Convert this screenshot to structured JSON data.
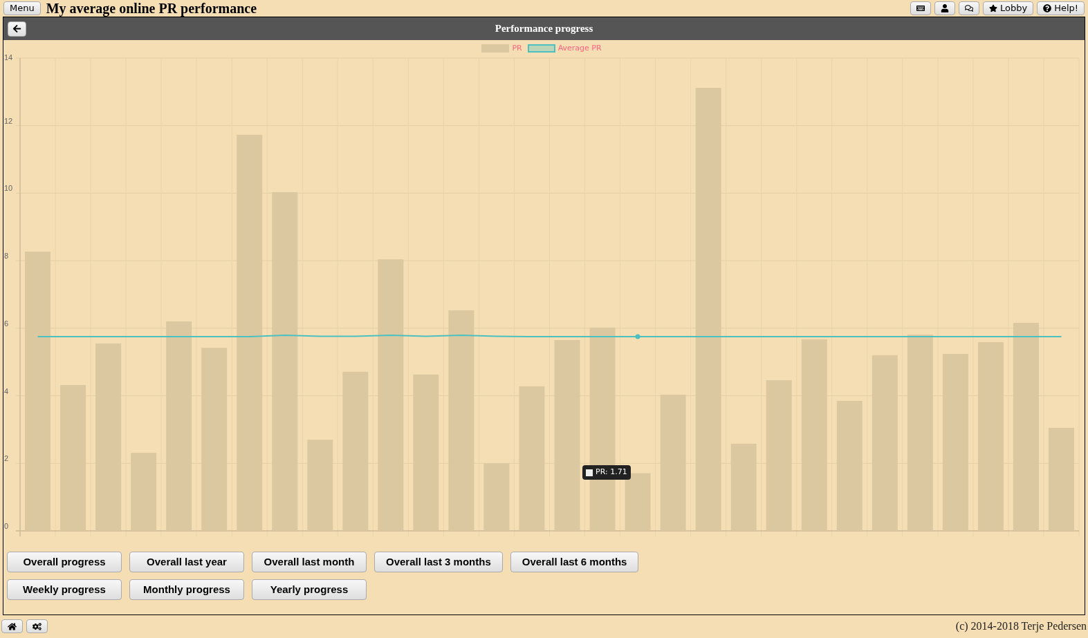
{
  "menu_button": "Menu",
  "page_title": "My average online PR performance",
  "toolbar": [
    {
      "kind": "keyboard"
    },
    {
      "kind": "user"
    },
    {
      "kind": "chat"
    },
    {
      "kind": "star",
      "label": "Lobby"
    },
    {
      "kind": "help",
      "label": "Help!"
    }
  ],
  "panel": {
    "title": "Performance progress",
    "chart_data": {
      "type": "bar",
      "grid": true,
      "legend": "top",
      "ylim": [
        0,
        14
      ],
      "yticks": [
        0,
        2,
        4,
        6,
        8,
        10,
        12,
        14
      ],
      "series": [
        {
          "name": "PR",
          "color": "#dcc8a0",
          "values": [
            8.27,
            4.32,
            5.55,
            2.31,
            6.2,
            5.42,
            11.73,
            10.03,
            2.7,
            4.71,
            8.04,
            4.63,
            6.53,
            2.0,
            4.28,
            5.65,
            6.02,
            1.71,
            4.03,
            13.12,
            2.58,
            4.46,
            5.67,
            3.85,
            5.2,
            5.81,
            5.24,
            5.59,
            6.16,
            3.05
          ]
        },
        {
          "name": "Average PR",
          "type": "line",
          "color": "#4bc0c0",
          "values": [
            5.75,
            5.75,
            5.75,
            5.75,
            5.75,
            5.75,
            5.75,
            5.79,
            5.76,
            5.76,
            5.79,
            5.76,
            5.79,
            5.76,
            5.75,
            5.75,
            5.75,
            5.75,
            5.75,
            5.75,
            5.75,
            5.75,
            5.75,
            5.75,
            5.75,
            5.75,
            5.75,
            5.75,
            5.75,
            5.75
          ]
        }
      ],
      "annotations": [
        "PR: 1.71"
      ]
    },
    "buttons": [
      [
        "Overall progress",
        "Overall last year",
        "Overall last month",
        "Overall last 3 months",
        "Overall last 6 months"
      ],
      [
        "Weekly progress",
        "Monthly progress",
        "Yearly progress"
      ]
    ]
  },
  "footer": {
    "buttons": [
      {
        "kind": "home"
      },
      {
        "kind": "settings"
      }
    ],
    "copyright": "(c) 2014-2018 Terje Pedersen"
  }
}
